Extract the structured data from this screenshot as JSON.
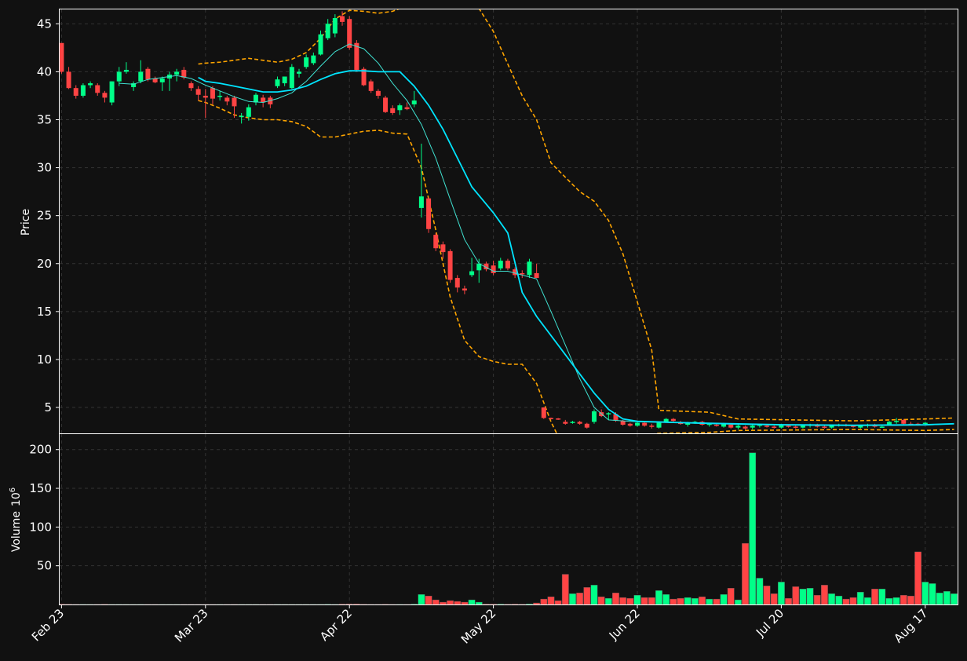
{
  "chart_data": {
    "type": "candlestick",
    "colors": {
      "background": "#111111",
      "up": "#00ff88",
      "down": "#ff4444",
      "ma_fast": "#40e0d0",
      "ma_slow": "#00e5ff",
      "band": "#ffa500",
      "grid": "#333333",
      "frame": "#ffffff"
    },
    "price_panel": {
      "ylabel": "Price",
      "ylim": [
        2.3,
        46.5
      ],
      "yticks": [
        5,
        10,
        15,
        20,
        25,
        30,
        35,
        40,
        45
      ]
    },
    "volume_panel": {
      "ylabel": "Volume",
      "unit_base": "10",
      "unit_exp": "6",
      "ylim": [
        0,
        220
      ],
      "yticks": [
        50,
        100,
        150,
        200
      ]
    },
    "x_ticks": [
      {
        "index": 0,
        "label": "Feb 23"
      },
      {
        "index": 20,
        "label": "Mar 23"
      },
      {
        "index": 40,
        "label": "Apr 22"
      },
      {
        "index": 60,
        "label": "May 22"
      },
      {
        "index": 80,
        "label": "Jun 22"
      },
      {
        "index": 100,
        "label": "Jul 20"
      },
      {
        "index": 120,
        "label": "Aug 17"
      }
    ],
    "candles": [
      [
        43,
        43,
        39.8,
        40
      ],
      [
        40,
        40.5,
        38.2,
        38.3
      ],
      [
        38.3,
        38.6,
        37.2,
        37.5
      ],
      [
        37.5,
        38.8,
        37.3,
        38.6
      ],
      [
        38.6,
        39,
        38.3,
        38.8
      ],
      [
        38.6,
        38.8,
        37.5,
        37.8
      ],
      [
        37.8,
        38,
        36.8,
        37.3
      ],
      [
        36.8,
        39,
        36.5,
        39
      ],
      [
        39,
        40.5,
        38.5,
        40
      ],
      [
        40,
        41,
        39.8,
        40.2
      ],
      [
        38.4,
        39,
        38,
        38.8
      ],
      [
        39,
        41.2,
        38.8,
        40
      ],
      [
        40.3,
        40.5,
        39,
        39.2
      ],
      [
        39.3,
        39.5,
        38.8,
        38.9
      ],
      [
        38.9,
        39.5,
        38,
        39.3
      ],
      [
        39.3,
        40,
        38,
        39.7
      ],
      [
        39.7,
        40.3,
        39,
        40
      ],
      [
        40.2,
        40.5,
        39.2,
        39.4
      ],
      [
        38.8,
        39,
        38,
        38.3
      ],
      [
        38.2,
        38.5,
        37,
        37.6
      ],
      [
        37.5,
        38.2,
        35.2,
        37.3
      ],
      [
        38.3,
        38.5,
        36.6,
        37.2
      ],
      [
        37.4,
        38,
        37,
        37.5
      ],
      [
        37.3,
        37.5,
        36.5,
        36.9
      ],
      [
        37.3,
        37.5,
        35.2,
        36.4
      ],
      [
        35.3,
        35.7,
        34.6,
        35.4
      ],
      [
        35.3,
        36.6,
        34.9,
        36.3
      ],
      [
        36.8,
        37.8,
        36.5,
        37.6
      ],
      [
        37.3,
        37.6,
        36.3,
        36.8
      ],
      [
        37.3,
        37.5,
        36.2,
        36.6
      ],
      [
        38.5,
        39.5,
        38.3,
        39.2
      ],
      [
        38.8,
        39.5,
        38.5,
        39.5
      ],
      [
        38.3,
        40.8,
        38.2,
        40.5
      ],
      [
        39.8,
        40.3,
        39.4,
        40
      ],
      [
        40.5,
        41.8,
        40.3,
        41.5
      ],
      [
        40.9,
        42,
        40.7,
        41.7
      ],
      [
        41.8,
        44.3,
        41.7,
        43.9
      ],
      [
        43.5,
        45.5,
        43.3,
        45
      ],
      [
        44,
        46,
        43.6,
        45.6
      ],
      [
        45.8,
        46.3,
        44.8,
        45.2
      ],
      [
        45.5,
        45.8,
        42.3,
        42.5
      ],
      [
        43,
        43.3,
        40,
        40.2
      ],
      [
        40.3,
        40.5,
        38.5,
        38.6
      ],
      [
        39,
        39.2,
        37.8,
        38
      ],
      [
        38,
        38.2,
        37.2,
        37.5
      ],
      [
        37.3,
        37.5,
        35.7,
        35.8
      ],
      [
        36.2,
        36.5,
        35.5,
        35.7
      ],
      [
        36,
        36.7,
        35.5,
        36.5
      ],
      [
        36.3,
        36.8,
        36,
        36.1
      ],
      [
        36.6,
        38,
        36.3,
        37
      ],
      [
        25.8,
        32.5,
        24.8,
        27
      ],
      [
        26.8,
        26.9,
        23.2,
        23.6
      ],
      [
        23,
        23.2,
        21.3,
        21.6
      ],
      [
        22,
        22.3,
        20.5,
        21.2
      ],
      [
        21.3,
        21.5,
        18,
        18.3
      ],
      [
        18.5,
        18.8,
        17,
        17.5
      ],
      [
        17.4,
        17.7,
        16.8,
        17.2
      ],
      [
        18.8,
        20.6,
        18.6,
        19.2
      ],
      [
        19.3,
        20.5,
        18,
        20
      ],
      [
        20,
        20.2,
        19.2,
        19.4
      ],
      [
        19.8,
        20.3,
        18.8,
        19
      ],
      [
        19.5,
        20.6,
        19.3,
        20.3
      ],
      [
        20.3,
        20.5,
        19.3,
        19.5
      ],
      [
        19.4,
        19.6,
        18.5,
        18.8
      ],
      [
        19,
        19.3,
        18.5,
        18.9
      ],
      [
        18.8,
        20.5,
        18.5,
        20.2
      ],
      [
        19,
        20,
        18.5,
        18.5
      ],
      [
        5,
        5,
        3.8,
        3.9
      ],
      [
        3.9,
        3.95,
        3.75,
        3.85
      ],
      [
        3.85,
        3.9,
        3.7,
        3.75
      ],
      [
        3.5,
        3.7,
        3.2,
        3.3
      ],
      [
        3.4,
        3.6,
        3.3,
        3.5
      ],
      [
        3.5,
        3.6,
        3.2,
        3.3
      ],
      [
        3.3,
        3.4,
        2.8,
        2.9
      ],
      [
        3.5,
        4.8,
        3.3,
        4.6
      ],
      [
        4.5,
        4.8,
        4,
        4.1
      ],
      [
        4.3,
        4.5,
        3.7,
        4.4
      ],
      [
        4.3,
        4.5,
        3.5,
        3.6
      ],
      [
        3.6,
        3.7,
        3.1,
        3.2
      ],
      [
        3.3,
        3.4,
        3,
        3.1
      ],
      [
        3.1,
        3.5,
        3,
        3.4
      ],
      [
        3.4,
        3.5,
        3,
        3.1
      ],
      [
        3.1,
        3.3,
        2.8,
        3
      ],
      [
        2.9,
        3.5,
        2.8,
        3.4
      ],
      [
        3.5,
        3.9,
        3.4,
        3.8
      ],
      [
        3.8,
        3.9,
        3.5,
        3.6
      ],
      [
        3.4,
        3.6,
        3.2,
        3.3
      ],
      [
        3.2,
        3.5,
        3,
        3.4
      ],
      [
        3.4,
        3.6,
        3.3,
        3.5
      ],
      [
        3.5,
        3.6,
        3.1,
        3.2
      ],
      [
        3.2,
        3.4,
        3,
        3.3
      ],
      [
        3.2,
        3.3,
        3,
        3.1
      ],
      [
        3,
        3.4,
        2.9,
        3.3
      ],
      [
        3.2,
        3.3,
        2.8,
        2.9
      ],
      [
        2.9,
        3.2,
        2.7,
        3.1
      ],
      [
        3,
        3.1,
        2.7,
        2.8
      ],
      [
        2.9,
        3.2,
        2.7,
        3.1
      ],
      [
        3.1,
        3.3,
        2.9,
        3.2
      ],
      [
        3.1,
        3.2,
        2.9,
        3
      ],
      [
        3,
        3.1,
        2.8,
        2.9
      ],
      [
        2.9,
        3.3,
        2.8,
        3.2
      ],
      [
        3.1,
        3.2,
        2.9,
        3
      ],
      [
        3,
        3.1,
        2.8,
        2.9
      ],
      [
        2.9,
        3.2,
        2.8,
        3.1
      ],
      [
        3.1,
        3.3,
        2.9,
        3.2
      ],
      [
        3.2,
        3.3,
        2.9,
        3
      ],
      [
        3,
        3.1,
        2.8,
        2.9
      ],
      [
        2.9,
        3.2,
        2.8,
        3.1
      ],
      [
        3.1,
        3.3,
        3,
        3.2
      ],
      [
        3.2,
        3.3,
        3,
        3.1
      ],
      [
        3.1,
        3.2,
        2.9,
        3
      ],
      [
        2.9,
        3.2,
        2.8,
        3.1
      ],
      [
        3.1,
        3.3,
        2.9,
        3.2
      ],
      [
        3.2,
        3.3,
        2.9,
        3
      ],
      [
        3,
        3.1,
        2.9,
        3
      ],
      [
        3.2,
        3.6,
        3.1,
        3.5
      ],
      [
        3.5,
        3.9,
        3.3,
        3.6
      ],
      [
        3.7,
        3.8,
        3.2,
        3.3
      ],
      [
        3.3,
        3.5,
        3.1,
        3.2
      ],
      [
        3.3,
        3.4,
        3.1,
        3.2
      ],
      [
        3.3,
        3.5,
        3.2,
        3.4
      ]
    ],
    "volume": [
      0.5,
      0.4,
      0.3,
      0.3,
      0.2,
      0.3,
      0.4,
      0.2,
      0.3,
      0.2,
      0.2,
      0.3,
      0.2,
      0.2,
      0.2,
      0.2,
      0.2,
      0.2,
      0.2,
      0.2,
      0.3,
      0.2,
      0.2,
      0.2,
      0.3,
      0.2,
      0.2,
      0.2,
      0.2,
      0.2,
      0.3,
      0.2,
      0.2,
      0.2,
      0.2,
      0.3,
      0.3,
      0.4,
      0.3,
      0.5,
      0.8,
      0.6,
      0.4,
      0.3,
      0.3,
      0.4,
      0.3,
      0.3,
      0.2,
      0.5,
      13,
      11,
      6,
      3,
      5,
      4,
      3,
      6,
      3,
      0.5,
      0.5,
      0.5,
      0.4,
      0.5,
      0.4,
      0.6,
      2,
      7,
      10,
      5,
      39,
      14,
      15,
      22,
      25,
      10,
      8,
      15,
      9,
      8,
      12,
      9,
      9,
      18,
      13,
      7,
      8,
      9,
      8,
      10,
      7,
      7,
      13,
      21,
      6,
      79,
      196,
      34,
      24,
      14,
      29,
      8,
      23,
      20,
      21,
      12,
      25,
      14,
      11,
      7,
      9,
      16,
      9,
      20,
      20,
      8,
      9,
      12,
      11,
      68,
      29,
      27,
      15,
      17,
      14,
      15
    ],
    "ma_fast": [
      [
        8,
        38.8
      ],
      [
        10,
        38.7
      ],
      [
        12,
        39.2
      ],
      [
        14,
        39.4
      ],
      [
        16,
        39.6
      ],
      [
        18,
        39.3
      ],
      [
        20,
        38.6
      ],
      [
        22,
        38
      ],
      [
        24,
        37.4
      ],
      [
        26,
        36.9
      ],
      [
        28,
        36.8
      ],
      [
        30,
        37.2
      ],
      [
        32,
        37.8
      ],
      [
        34,
        39
      ],
      [
        36,
        40.6
      ],
      [
        38,
        42.1
      ],
      [
        40,
        42.9
      ],
      [
        42,
        42.4
      ],
      [
        44,
        40.9
      ],
      [
        46,
        38.8
      ],
      [
        48,
        37
      ],
      [
        50,
        34.5
      ],
      [
        52,
        31
      ],
      [
        54,
        26.7
      ],
      [
        56,
        22.5
      ],
      [
        58,
        20
      ],
      [
        60,
        19.2
      ],
      [
        62,
        19.2
      ],
      [
        64,
        18.8
      ],
      [
        66,
        18.4
      ],
      [
        68,
        15
      ],
      [
        70,
        11.5
      ],
      [
        72,
        8
      ],
      [
        74,
        5
      ],
      [
        76,
        3.7
      ],
      [
        78,
        3.6
      ],
      [
        80,
        3.5
      ],
      [
        90,
        3.3
      ],
      [
        100,
        3.15
      ],
      [
        110,
        3.1
      ],
      [
        120,
        3.15
      ],
      [
        124,
        3.3
      ]
    ],
    "ma_slow": [
      [
        19,
        39.4
      ],
      [
        20,
        39
      ],
      [
        22,
        38.8
      ],
      [
        24,
        38.5
      ],
      [
        26,
        38.2
      ],
      [
        28,
        37.9
      ],
      [
        30,
        37.9
      ],
      [
        32,
        38.1
      ],
      [
        34,
        38.5
      ],
      [
        36,
        39.2
      ],
      [
        38,
        39.8
      ],
      [
        40,
        40.1
      ],
      [
        42,
        40.1
      ],
      [
        44,
        40
      ],
      [
        47,
        40
      ],
      [
        49,
        38.5
      ],
      [
        51,
        36.5
      ],
      [
        53,
        34
      ],
      [
        55,
        31
      ],
      [
        57,
        28
      ],
      [
        60,
        25.3
      ],
      [
        62,
        23.2
      ],
      [
        64,
        17
      ],
      [
        66,
        14.5
      ],
      [
        68,
        12.5
      ],
      [
        70,
        10.5
      ],
      [
        72,
        8.5
      ],
      [
        74,
        6.5
      ],
      [
        76,
        4.8
      ],
      [
        78,
        3.8
      ],
      [
        80,
        3.55
      ],
      [
        85,
        3.45
      ],
      [
        90,
        3.35
      ],
      [
        100,
        3.2
      ],
      [
        110,
        3.15
      ],
      [
        120,
        3.2
      ],
      [
        124,
        3.3
      ]
    ],
    "band_upper": [
      [
        19,
        40.8
      ],
      [
        20,
        40.9
      ],
      [
        22,
        41
      ],
      [
        24,
        41.2
      ],
      [
        26,
        41.4
      ],
      [
        28,
        41.2
      ],
      [
        30,
        41
      ],
      [
        32,
        41.3
      ],
      [
        34,
        42
      ],
      [
        36,
        43.5
      ],
      [
        38,
        45.5
      ],
      [
        40,
        46.4
      ],
      [
        42,
        46.3
      ],
      [
        44,
        46.1
      ],
      [
        46,
        46.3
      ],
      [
        47,
        46.6
      ],
      [
        58,
        46.6
      ],
      [
        60,
        44.2
      ],
      [
        62,
        40.8
      ],
      [
        64,
        37.5
      ],
      [
        66,
        35
      ],
      [
        68,
        30.5
      ],
      [
        70,
        29
      ],
      [
        72,
        27.5
      ],
      [
        74,
        26.5
      ],
      [
        76,
        24.5
      ],
      [
        78,
        21
      ],
      [
        80,
        16
      ],
      [
        82,
        11
      ],
      [
        83,
        4.7
      ],
      [
        90,
        4.5
      ],
      [
        94,
        3.8
      ],
      [
        110,
        3.6
      ],
      [
        120,
        3.8
      ],
      [
        124,
        3.9
      ]
    ],
    "band_lower": [
      [
        19,
        37
      ],
      [
        20,
        36.8
      ],
      [
        22,
        36.2
      ],
      [
        24,
        35.5
      ],
      [
        26,
        35.2
      ],
      [
        28,
        35
      ],
      [
        30,
        35
      ],
      [
        32,
        34.8
      ],
      [
        34,
        34.3
      ],
      [
        36,
        33.2
      ],
      [
        38,
        33.2
      ],
      [
        40,
        33.5
      ],
      [
        42,
        33.8
      ],
      [
        44,
        33.9
      ],
      [
        46,
        33.6
      ],
      [
        48,
        33.5
      ],
      [
        50,
        30
      ],
      [
        52,
        23.5
      ],
      [
        54,
        16.5
      ],
      [
        56,
        12
      ],
      [
        58,
        10.3
      ],
      [
        60,
        9.8
      ],
      [
        62,
        9.5
      ],
      [
        64,
        9.5
      ],
      [
        66,
        7.5
      ],
      [
        68,
        3.5
      ],
      [
        69,
        2
      ],
      [
        80,
        2
      ],
      [
        83,
        2.3
      ],
      [
        90,
        2.4
      ],
      [
        94,
        2.6
      ],
      [
        110,
        2.7
      ],
      [
        120,
        2.6
      ],
      [
        124,
        2.7
      ]
    ]
  }
}
